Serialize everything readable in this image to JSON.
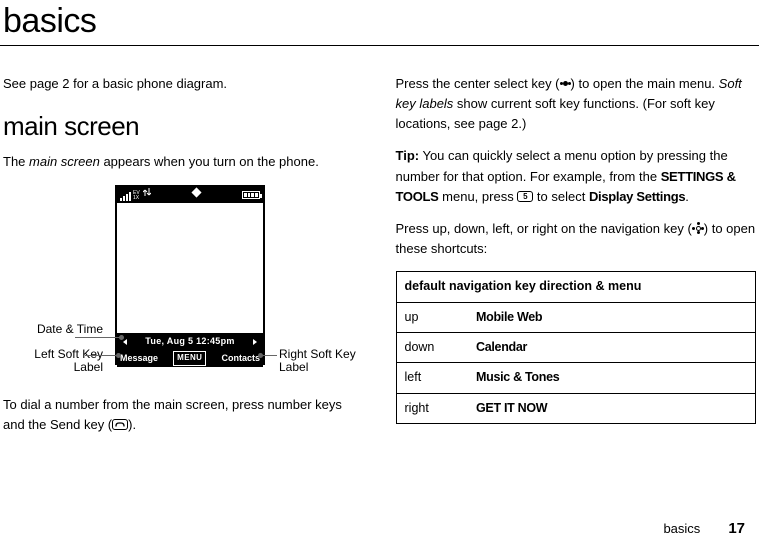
{
  "title": "basics",
  "intro": "See page 2 for a basic phone diagram.",
  "section1_heading": "main screen",
  "section1_text_a": "The ",
  "section1_text_b": "main screen",
  "section1_text_c": " appears when you turn on the phone.",
  "phone": {
    "date_time": "Tue, Aug 5  12:45pm",
    "left_soft": "Message",
    "menu_label": "MENU",
    "right_soft": "Contacts"
  },
  "callouts": {
    "date_time": "Date & Time",
    "left_label_l1": "Left Soft Key",
    "left_label_l2": "Label",
    "right_label_l1": "Right Soft Key",
    "right_label_l2": "Label"
  },
  "dial_text": "To dial a number from the main screen, press number keys and the Send key (",
  "dial_text_end": ").",
  "col2_p1_a": "Press the center select key (",
  "col2_p1_b": ") to open the main menu. ",
  "col2_p1_c": "Soft key labels",
  "col2_p1_d": " show current soft key functions. (For soft key locations, see page 2.)",
  "tip_label": "Tip:",
  "tip_a": " You can quickly select a menu option by pressing the number for that option. For example, from the ",
  "tip_b": "SETTINGS & TOOLS",
  "tip_c": " menu, press ",
  "tip_key": "5",
  "tip_d": " to select ",
  "tip_e": "Display Settings",
  "tip_f": ".",
  "col2_p3_a": "Press up, down, left, or right on the navigation key (",
  "col2_p3_b": ") to open these shortcuts:",
  "table_header": "default navigation key direction & menu",
  "table": [
    {
      "dir": "up",
      "menu": "Mobile Web"
    },
    {
      "dir": "down",
      "menu": "Calendar"
    },
    {
      "dir": "left",
      "menu": "Music & Tones"
    },
    {
      "dir": "right",
      "menu": "GET IT NOW"
    }
  ],
  "footer_label": "basics",
  "footer_page": "17",
  "send_key_glyph": "📞"
}
